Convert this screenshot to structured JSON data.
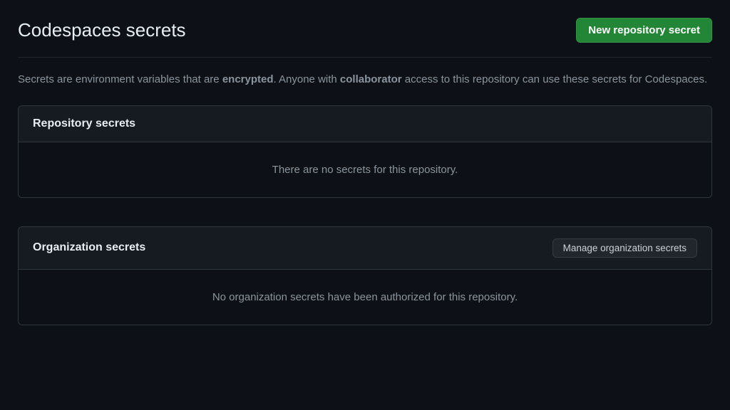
{
  "header": {
    "title": "Codespaces secrets",
    "new_secret_button": "New repository secret"
  },
  "description": {
    "part1": "Secrets are environment variables that are ",
    "bold1": "encrypted",
    "part2": ". Anyone with ",
    "bold2": "collaborator",
    "part3": " access to this repository can use these secrets for Codespaces."
  },
  "repo_section": {
    "title": "Repository secrets",
    "empty_message": "There are no secrets for this repository."
  },
  "org_section": {
    "title": "Organization secrets",
    "manage_button": "Manage organization secrets",
    "empty_message": "No organization secrets have been authorized for this repository."
  }
}
